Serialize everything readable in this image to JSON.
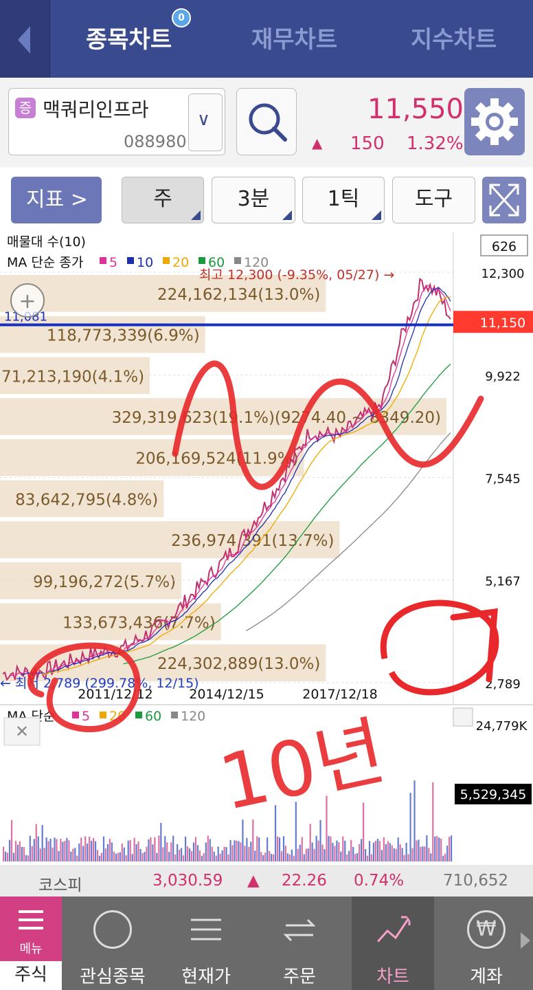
{
  "header": {
    "tabs": [
      "종목차트",
      "재무차트",
      "지수차트"
    ],
    "badge": "0"
  },
  "stock": {
    "tag": "증",
    "name": "맥쿼리인프라",
    "code": "088980",
    "price": "11,550",
    "change": "150",
    "change_pct": "1.32%",
    "direction": "▲"
  },
  "toolbar": {
    "indicator": "지표 >",
    "period": "주",
    "minute": "3분",
    "tick": "1틱",
    "tool": "도구"
  },
  "chart_data": {
    "type": "line",
    "title": "",
    "top_labels": {
      "volume_profile": "매물대 수(10)",
      "ma_label": "MA 단순 종가",
      "ma_periods": [
        "5",
        "10",
        "20",
        "60",
        "120"
      ],
      "ma_colors": [
        "#e0309a",
        "#1c2fb0",
        "#f0a800",
        "#1a9a3a",
        "#888888"
      ],
      "count_box": "626"
    },
    "price_axis": [
      "12,300",
      "9,922",
      "7,545",
      "5,167",
      "2,789"
    ],
    "current_price_label": "11,150",
    "current_price_color": "#ff3b30",
    "reference_line_label": "11,081",
    "high_label": "최고 12,300 (-9.35%, 05/27) →",
    "low_label": "← 최저 2,789 (299.78%, 12/15)",
    "x_ticks": [
      "2011/12/12",
      "2014/12/15",
      "2017/12/18"
    ],
    "ylim": [
      2789,
      12300
    ],
    "volume_profile": [
      {
        "text": "224,162,134(13.0%)",
        "pct": 13.0
      },
      {
        "text": "118,773,339(6.9%)",
        "pct": 6.9
      },
      {
        "text": "71,213,190(4.1%)",
        "pct": 4.1
      },
      {
        "text": "329,319,623(19.1%)(9274.40 ~ 8349.20)",
        "pct": 19.1
      },
      {
        "text": "206,169,524(11.9%)",
        "pct": 11.9
      },
      {
        "text": "83,642,795(4.8%)",
        "pct": 4.8
      },
      {
        "text": "236,974,391(13.7%)",
        "pct": 13.7
      },
      {
        "text": "99,196,272(5.7%)",
        "pct": 5.7
      },
      {
        "text": "133,673,436(7.7%)",
        "pct": 7.7
      },
      {
        "text": "224,302,889(13.0%)",
        "pct": 13.0
      }
    ],
    "volume_panel": {
      "label": "MA 단순",
      "periods": [
        "5",
        "20",
        "60",
        "120"
      ],
      "colors": [
        "#e0309a",
        "#f0a800",
        "#1a9a3a",
        "#888888"
      ],
      "max_label": "24,779K",
      "current_label": "5,529,345"
    },
    "annotation": {
      "handwritten": "10년"
    }
  },
  "kospi": {
    "name": "코스피",
    "value": "3,030.59",
    "direction": "▲",
    "change": "22.26",
    "pct": "0.74%",
    "volume": "710,652"
  },
  "nav": {
    "menu_label": "메뉴",
    "items": [
      "주식",
      "관심종목",
      "현재가",
      "주문",
      "차트",
      "계좌"
    ]
  }
}
